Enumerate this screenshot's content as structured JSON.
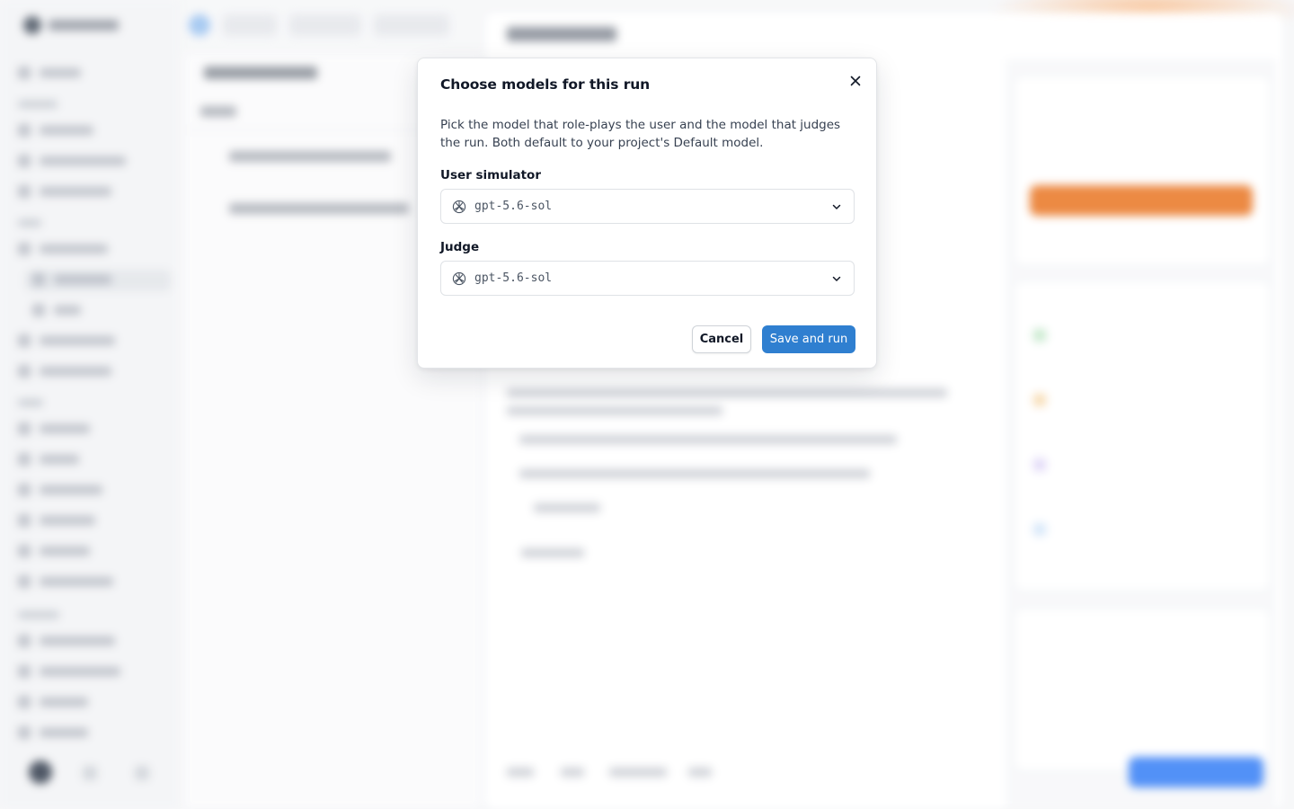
{
  "modal": {
    "title": "Choose models for this run",
    "description": "Pick the model that role-plays the user and the model that judges the run. Both default to your project's Default model.",
    "user_simulator": {
      "label": "User simulator",
      "selected_value": "gpt-5.6-sol",
      "icon": "openai-icon"
    },
    "judge": {
      "label": "Judge",
      "selected_value": "gpt-5.6-sol",
      "icon": "openai-icon"
    },
    "actions": {
      "cancel_label": "Cancel",
      "primary_label": "Save and run"
    },
    "close_icon": "close-icon"
  },
  "colors": {
    "primary_button": "#2f7fd0",
    "background_accent_orange": "#ea7a2a",
    "background_accent_blue": "#3b82f6"
  }
}
